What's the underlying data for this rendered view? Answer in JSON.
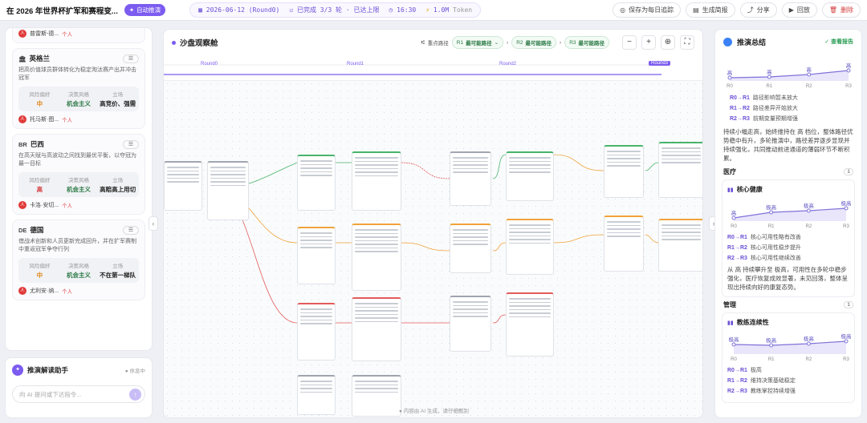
{
  "topbar": {
    "title": "在 2026 年世界杯扩军和赛程变...",
    "auto_badge": "自动推演",
    "status": {
      "date": "2026-06-12 (Round0)",
      "rounds": "已完成 3/3 轮 · 已达上限",
      "time": "16:30",
      "tokens": "1.0M",
      "tokens_unit": "Token"
    },
    "actions": {
      "save": "保存为每日追踪",
      "report": "生成简报",
      "share": "分享",
      "replay": "回放",
      "delete": "删除"
    }
  },
  "countries": [
    {
      "code": "",
      "name": "",
      "desc": "",
      "stats": [],
      "persona": "普雷斯-德...",
      "tag": "个人",
      "partial": true
    },
    {
      "code": "🏛",
      "name": "英格兰",
      "desc": "把高价值球员群体转化为稳定淘汰赛产出并冲击冠军",
      "stats": [
        {
          "k": "风险偏好",
          "v": "中",
          "color": "#e08a1a"
        },
        {
          "k": "决策风格",
          "v": "机会主义",
          "color": "#2c7a46"
        },
        {
          "k": "立场",
          "v": "高竞价、强需",
          "color": "#333"
        }
      ],
      "persona": "托马斯·图...",
      "tag": "个人"
    },
    {
      "code": "BR",
      "name": "巴西",
      "desc": "在高天赋与高波动之间找到最优平衡，以夺冠为最一目标",
      "stats": [
        {
          "k": "风险偏好",
          "v": "高",
          "color": "#d23a3a"
        },
        {
          "k": "决策风格",
          "v": "机会主义",
          "color": "#2c7a46"
        },
        {
          "k": "立场",
          "v": "高赔高上用切",
          "color": "#333"
        }
      ],
      "persona": "卡洛·安切...",
      "tag": "个人"
    },
    {
      "code": "DE",
      "name": "德国",
      "desc": "借战术创新和人员更新完成回升，并在扩军赛制中重返冠军争夺行列",
      "stats": [
        {
          "k": "风险偏好",
          "v": "中",
          "color": "#e08a1a"
        },
        {
          "k": "决策风格",
          "v": "机会主义",
          "color": "#2c7a46"
        },
        {
          "k": "立场",
          "v": "不在第一梯队",
          "color": "#333"
        }
      ],
      "persona": "尤利安·纳...",
      "tag": "个人"
    }
  ],
  "assistant": {
    "title": "推演解读助手",
    "status": "休息中",
    "placeholder": "向 AI 提问或下达指令..."
  },
  "canvas": {
    "title": "沙盘观察舱",
    "path_label": "重点路径",
    "paths": [
      {
        "id": "R1",
        "label": "最可能路径"
      },
      {
        "id": "R2",
        "label": "最可能路径"
      },
      {
        "id": "R3",
        "label": "最可能路径"
      }
    ],
    "timeline": [
      "Round0",
      "Round1",
      "Round2",
      "Round3"
    ],
    "footer": "内容由 AI 生成，请仔细甄别"
  },
  "summary": {
    "title": "推演总结",
    "link": "查看报告",
    "chart1": {
      "levels": [
        "高",
        "高",
        "高",
        "高"
      ],
      "rounds": [
        "R0",
        "R1",
        "R2",
        "R3"
      ],
      "values": [
        1,
        1.05,
        1.2,
        1.45
      ]
    },
    "legend1": [
      {
        "k": "R0→R1",
        "v": "路径影响暂未放大"
      },
      {
        "k": "R1→R2",
        "v": "路径差异开始放大"
      },
      {
        "k": "R2→R3",
        "v": "前期变量预期增强"
      }
    ],
    "text1": "持续小幅走高，始终维持在 高 档位，整体路径优势稳中有升，多轮推演中，路径差异逐步显现并持续强化，共同推动前进通道的薄弱环节不断积累。",
    "section_medical": {
      "title": "医疗",
      "badge": "1"
    },
    "card_health": {
      "title": "核心健康",
      "levels": [
        "高",
        "极高",
        "极高",
        "极高"
      ],
      "rounds": [
        "R0",
        "R1",
        "R2",
        "R3"
      ],
      "values": [
        1,
        1.35,
        1.45,
        1.6
      ],
      "legend": [
        {
          "k": "R0→R1",
          "v": "核心可用性略有改善"
        },
        {
          "k": "R1→R2",
          "v": "核心可用性稳步提升"
        },
        {
          "k": "R2→R3",
          "v": "核心可用性继续改善"
        }
      ],
      "text": "从 高 持续攀升至 极高，可用性在多轮中稳步强化，医疗恢复成效显著，未见回落，整体呈现出持续向好的康复态势。"
    },
    "section_manage": {
      "title": "管理",
      "badge": "1"
    },
    "card_coach": {
      "title": "教练连续性",
      "levels": [
        "极高",
        "极高",
        "极高",
        "极高"
      ],
      "rounds": [
        "R0",
        "R1",
        "R2",
        "R3"
      ],
      "values": [
        1.4,
        1.35,
        1.45,
        1.6
      ],
      "legend": [
        {
          "k": "R0→R1",
          "v": "极高"
        },
        {
          "k": "R1→R2",
          "v": "维持决策基础稳定"
        },
        {
          "k": "R2→R3",
          "v": "教练掌控持续增强"
        }
      ]
    },
    "colors": {
      "accent": "#7c5cf0",
      "line": "#7f73d8"
    }
  }
}
